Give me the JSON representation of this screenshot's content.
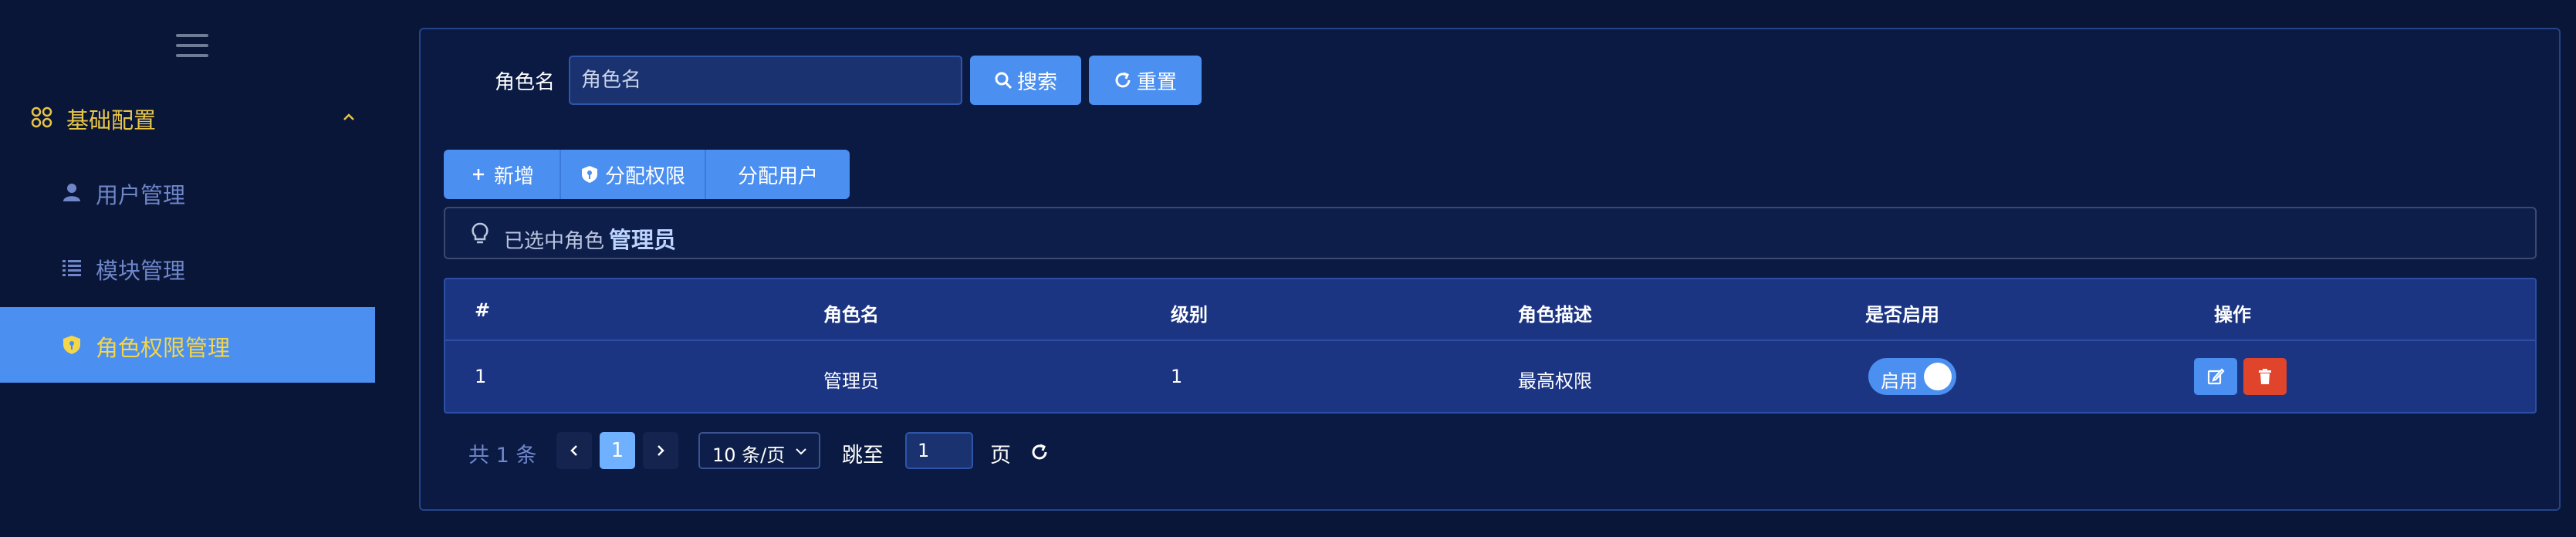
{
  "sidebar": {
    "group_label": "基础配置",
    "items": [
      {
        "label": "用户管理",
        "icon": "user-icon"
      },
      {
        "label": "模块管理",
        "icon": "list-icon"
      },
      {
        "label": "角色权限管理",
        "icon": "shield-icon",
        "active": true
      }
    ]
  },
  "search": {
    "label": "角色名",
    "placeholder": "角色名",
    "search_button": "搜索",
    "reset_button": "重置"
  },
  "toolbar": {
    "add_label": "新增",
    "assign_perm_label": "分配权限",
    "assign_user_label": "分配用户"
  },
  "alert": {
    "prefix": "已选中角色",
    "role": "管理员"
  },
  "table": {
    "headers": [
      "#",
      "角色名",
      "级别",
      "角色描述",
      "是否启用",
      "操作"
    ],
    "rows": [
      {
        "index": "1",
        "name": "管理员",
        "level": "1",
        "desc": "最高权限",
        "enabled_label": "启用",
        "enabled": true
      }
    ]
  },
  "pager": {
    "total": "共 1 条",
    "current": "1",
    "page_size": "10 条/页",
    "jump_label": "跳至",
    "jump_value": "1",
    "page_label": "页"
  },
  "colors": {
    "background": "#091638",
    "accent": "#4b8ff0",
    "active_text": "#f4d64a",
    "menu_text": "#6f86c9",
    "danger": "#e0452c"
  }
}
